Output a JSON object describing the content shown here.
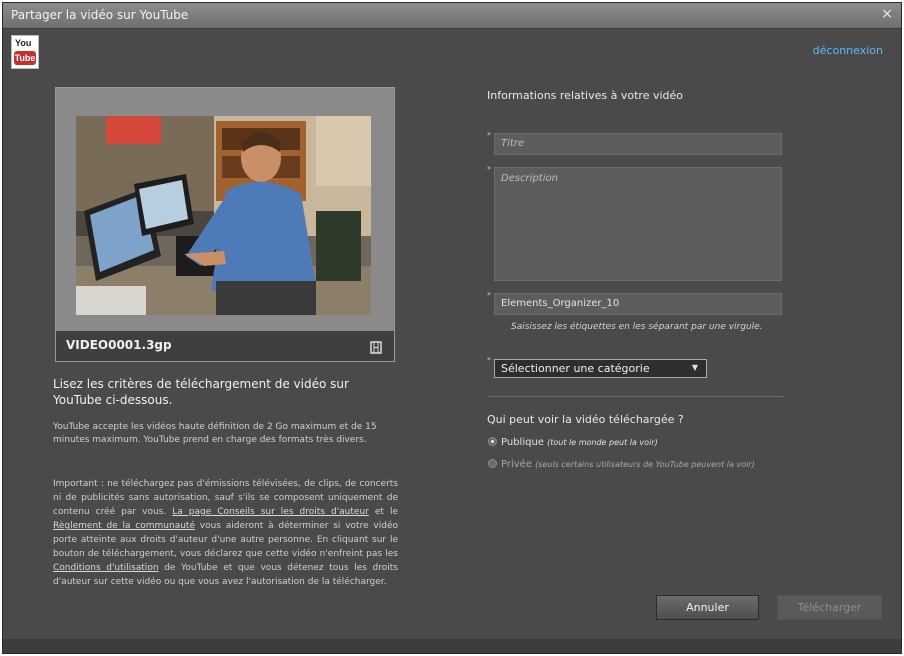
{
  "window": {
    "title": "Partager la vidéo sur YouTube",
    "close_glyph": "×"
  },
  "logo": {
    "top": "You",
    "bottom": "Tube"
  },
  "header": {
    "logout_label": "déconnexion"
  },
  "preview": {
    "filename": "VIDEO0001.3gp",
    "icon": "film-icon"
  },
  "criteria": {
    "title": "Lisez les critères de téléchargement de vidéo sur YouTube ci-dessous.",
    "body": "YouTube accepte les vidéos haute définition de 2 Go maximum et de 15 minutes maximum. YouTube prend en charge des formats très divers.",
    "legal_part1": "Important : ne téléchargez pas d'émissions télévisées, de clips, de concerts ni de publicités sans autorisation, sauf s'ils se composent uniquement de contenu créé par vous. ",
    "legal_link1": "La page Conseils sur les droits d'auteur",
    "legal_part2": " et le ",
    "legal_link2": "Règlement de la communauté",
    "legal_part3": " vous aideront à déterminer si votre vidéo porte atteinte aux droits d'auteur d'une autre personne. En cliquant sur le bouton de téléchargement, vous déclarez que cette vidéo n'enfreint pas les ",
    "legal_link3": "Conditions d'utilisation",
    "legal_part4": " de YouTube et que vous détenez tous les droits d'auteur sur cette vidéo ou que vous avez l'autorisation de la télécharger."
  },
  "form": {
    "section_title": "Informations relatives à votre vidéo",
    "required_mark": "*",
    "title_placeholder": "Titre",
    "description_placeholder": "Description",
    "tags_value": "Elements_Organizer_10",
    "tags_hint": "Saisissez les étiquettes en les séparant par une virgule.",
    "category_selected": "Sélectionner une catégorie",
    "arrow_glyph": "▼"
  },
  "visibility": {
    "title": "Qui peut voir la vidéo téléchargée ?",
    "public_label": "Publique",
    "public_note": "(tout le monde peut la voir)",
    "private_label": "Privée",
    "private_note": "(seuls certains utilisateurs de YouTube peuvent la voir)",
    "selected": "public"
  },
  "buttons": {
    "cancel_label": "Annuler",
    "upload_label": "Télécharger"
  },
  "colors": {
    "window_bg": "#4a4a4a",
    "link": "#5fb8f0",
    "youtube_red": "#c4302b"
  }
}
